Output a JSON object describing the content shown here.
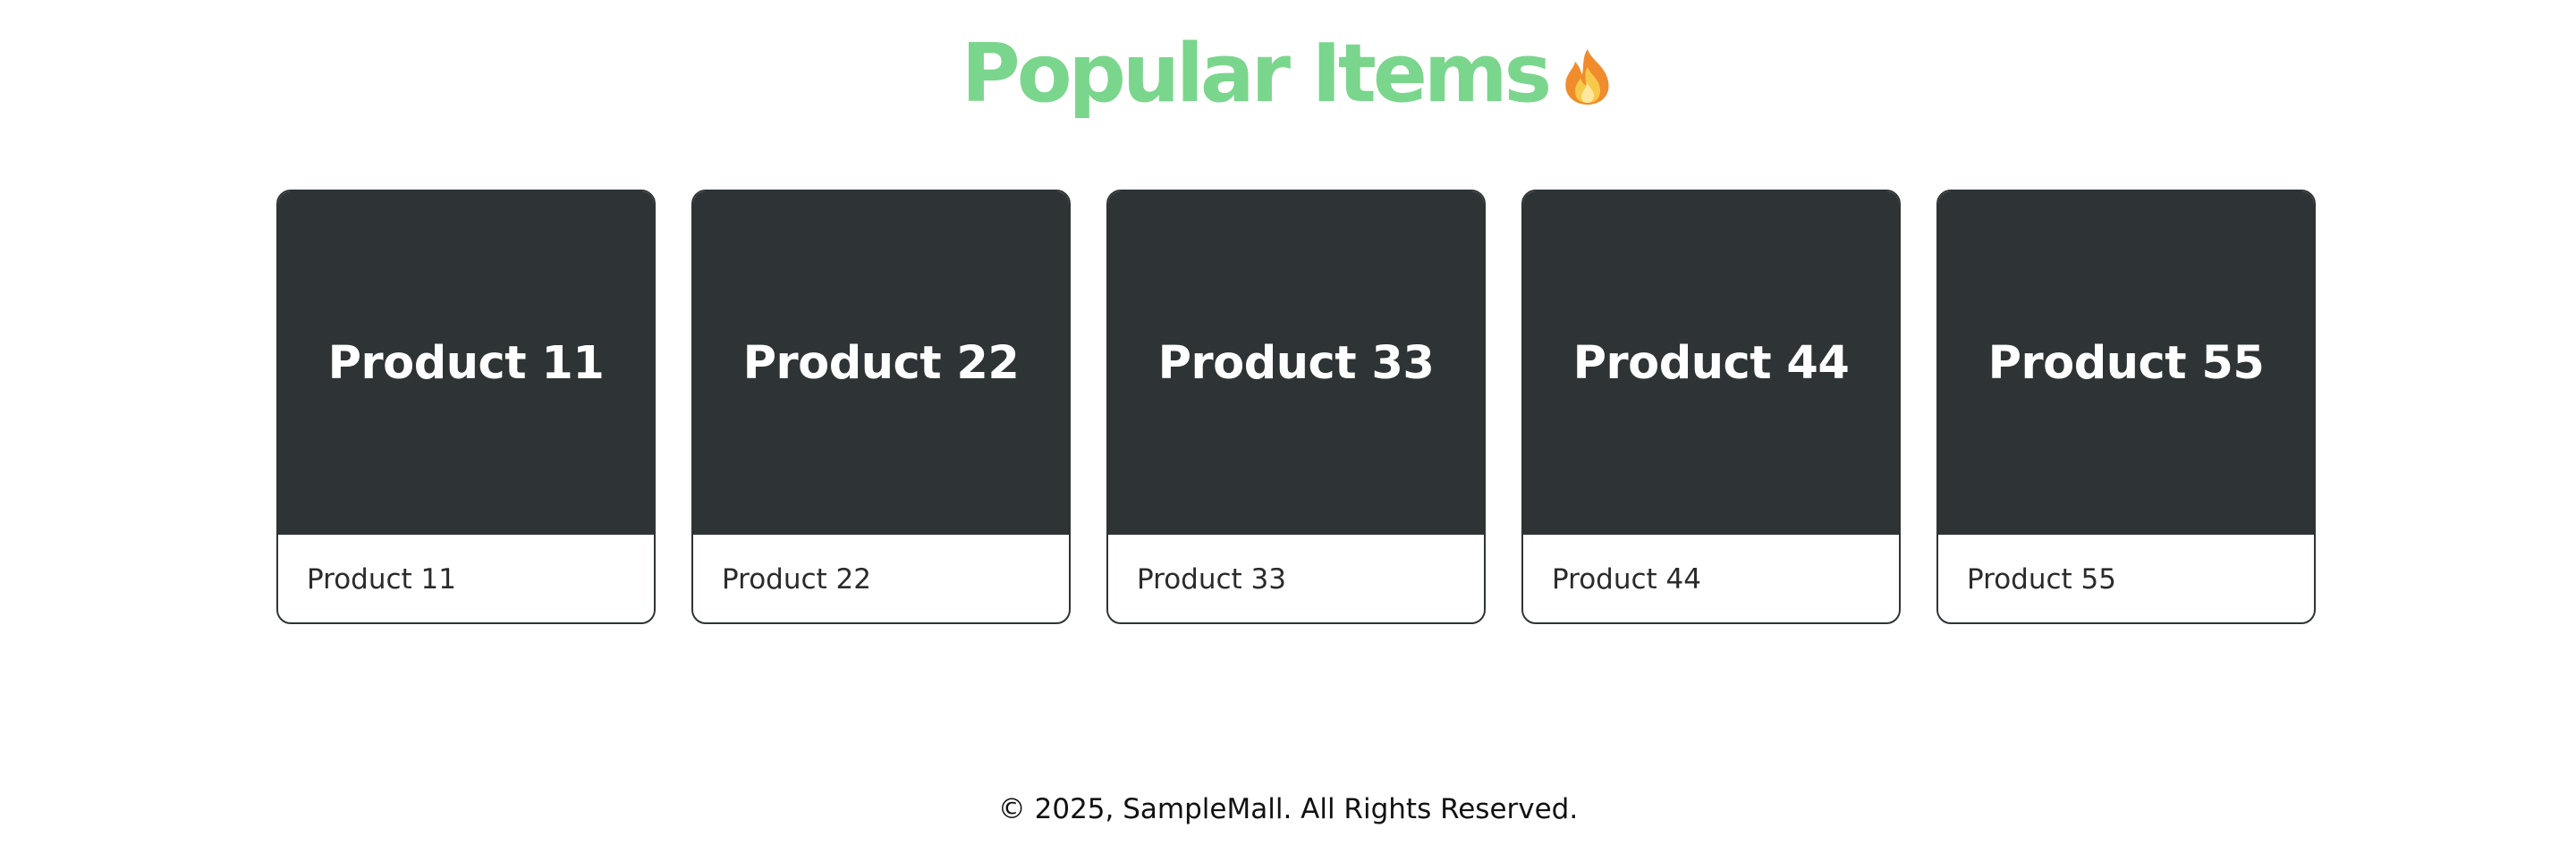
{
  "header": {
    "title": "Popular Items",
    "title_icon": "fire-icon",
    "title_color": "#7ad68c"
  },
  "colors": {
    "card_image_bg": "#2e3436",
    "card_border": "#2e3436"
  },
  "products": [
    {
      "image_text": "Product 11",
      "title": "Product 11"
    },
    {
      "image_text": "Product 22",
      "title": "Product 22"
    },
    {
      "image_text": "Product 33",
      "title": "Product 33"
    },
    {
      "image_text": "Product 44",
      "title": "Product 44"
    },
    {
      "image_text": "Product 55",
      "title": "Product 55"
    }
  ],
  "footer": {
    "text": "© 2025, SampleMall. All Rights Reserved."
  }
}
